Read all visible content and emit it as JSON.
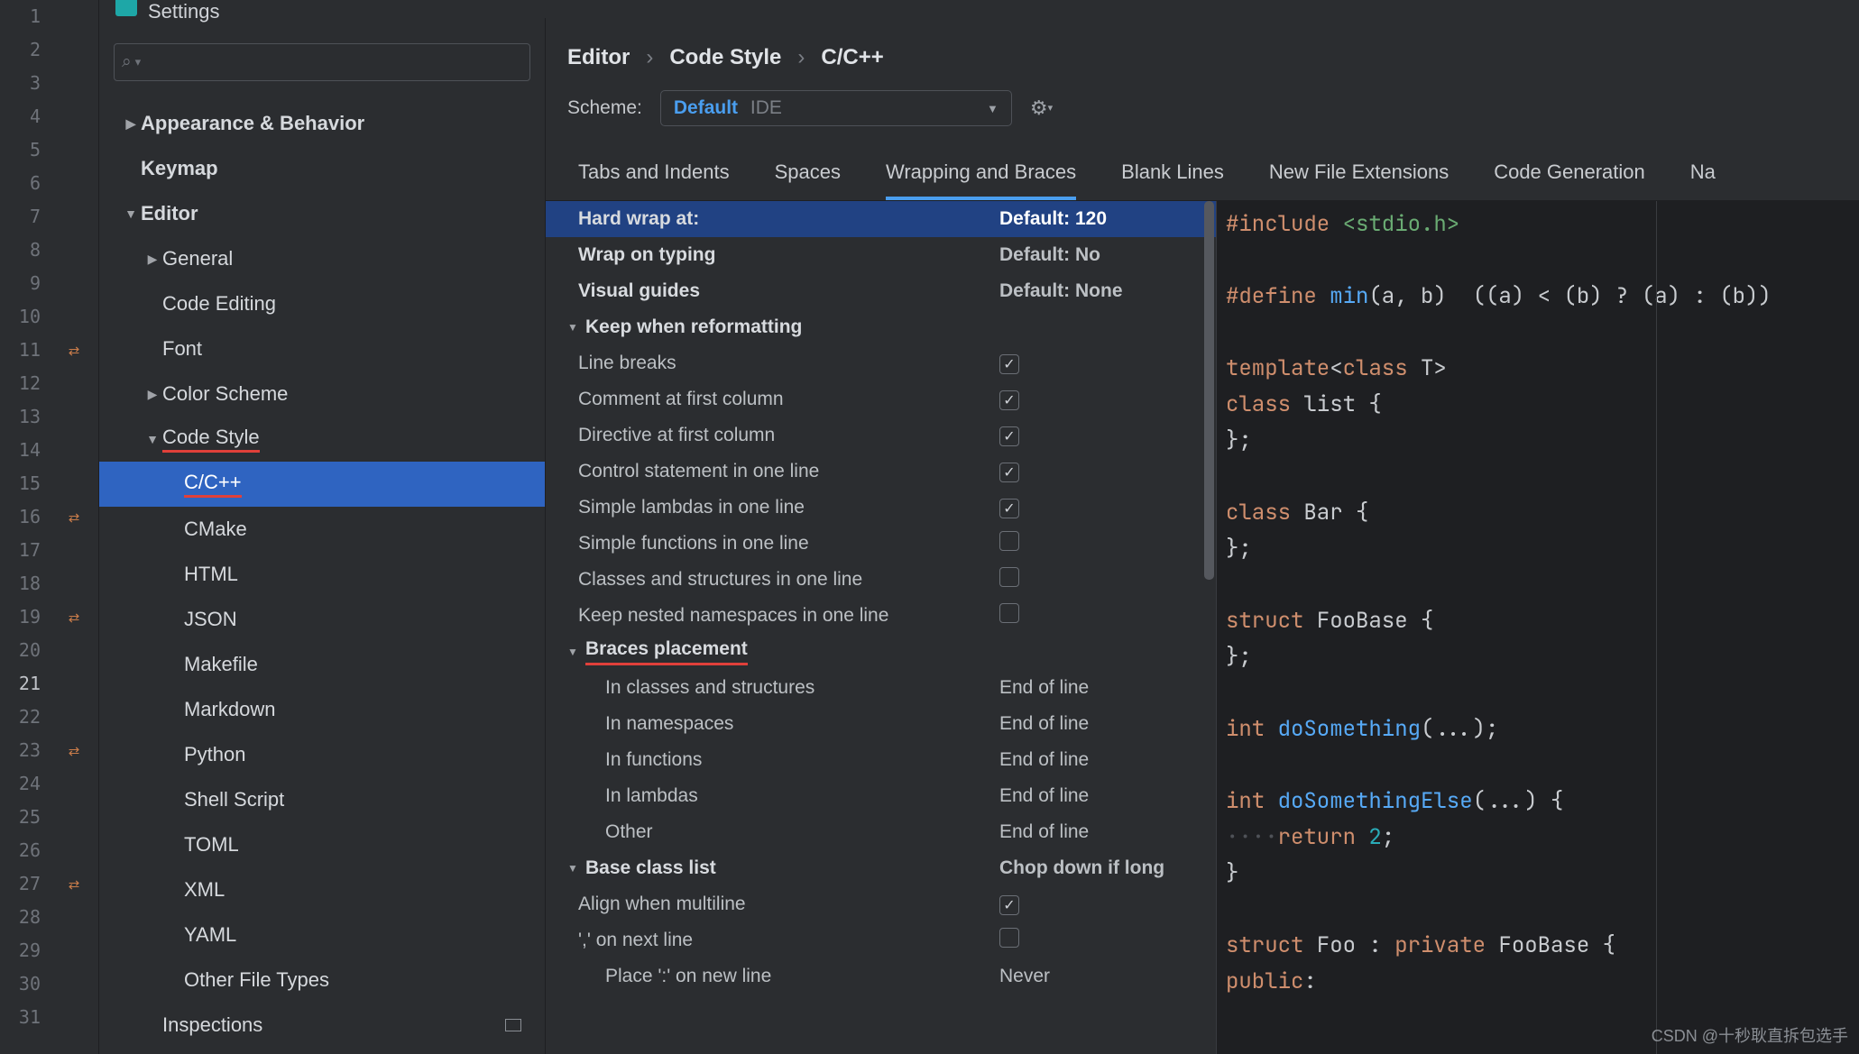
{
  "gutter": {
    "start": 1,
    "end": 31,
    "highlight": 21
  },
  "title": "Settings",
  "search_placeholder": "",
  "tree": [
    {
      "label": "Appearance & Behavior",
      "level": 1,
      "bold": true,
      "arrow": "right"
    },
    {
      "label": "Keymap",
      "level": 1,
      "bold": true,
      "arrow": ""
    },
    {
      "label": "Editor",
      "level": 1,
      "bold": true,
      "arrow": "down"
    },
    {
      "label": "General",
      "level": 2,
      "arrow": "right"
    },
    {
      "label": "Code Editing",
      "level": 2,
      "arrow": ""
    },
    {
      "label": "Font",
      "level": 2,
      "arrow": ""
    },
    {
      "label": "Color Scheme",
      "level": 2,
      "arrow": "right"
    },
    {
      "label": "Code Style",
      "level": 2,
      "arrow": "down",
      "underline": true
    },
    {
      "label": "C/C++",
      "level": 3,
      "sel": true,
      "underline": true
    },
    {
      "label": "CMake",
      "level": 3
    },
    {
      "label": "HTML",
      "level": 3
    },
    {
      "label": "JSON",
      "level": 3
    },
    {
      "label": "Makefile",
      "level": 3
    },
    {
      "label": "Markdown",
      "level": 3
    },
    {
      "label": "Python",
      "level": 3
    },
    {
      "label": "Shell Script",
      "level": 3
    },
    {
      "label": "TOML",
      "level": 3
    },
    {
      "label": "XML",
      "level": 3
    },
    {
      "label": "YAML",
      "level": 3
    },
    {
      "label": "Other File Types",
      "level": 3
    },
    {
      "label": "Inspections",
      "level": 2,
      "icon": "box"
    }
  ],
  "breadcrumb": [
    "Editor",
    "Code Style",
    "C/C++"
  ],
  "scheme": {
    "label": "Scheme:",
    "main": "Default",
    "sub": "IDE"
  },
  "tabs": [
    "Tabs and Indents",
    "Spaces",
    "Wrapping and Braces",
    "Blank Lines",
    "New File Extensions",
    "Code Generation",
    "Na"
  ],
  "active_tab": 2,
  "options": [
    {
      "type": "row",
      "label": "Hard wrap at:",
      "val": "Default: 120",
      "sel": true,
      "bold": true
    },
    {
      "type": "row",
      "label": "Wrap on typing",
      "val": "Default: No",
      "bold": true
    },
    {
      "type": "row",
      "label": "Visual guides",
      "val": "Default: None",
      "bold": true
    },
    {
      "type": "group",
      "label": "Keep when reformatting"
    },
    {
      "type": "chk",
      "label": "Line breaks",
      "on": true
    },
    {
      "type": "chk",
      "label": "Comment at first column",
      "on": true
    },
    {
      "type": "chk",
      "label": "Directive at first column",
      "on": true
    },
    {
      "type": "chk",
      "label": "Control statement in one line",
      "on": true
    },
    {
      "type": "chk",
      "label": "Simple lambdas in one line",
      "on": true
    },
    {
      "type": "chk",
      "label": "Simple functions in one line",
      "on": false
    },
    {
      "type": "chk",
      "label": "Classes and structures in one line",
      "on": false
    },
    {
      "type": "chk",
      "label": "Keep nested namespaces in one line",
      "on": false
    },
    {
      "type": "group",
      "label": "Braces placement",
      "underline": true
    },
    {
      "type": "row",
      "label": "In classes and structures",
      "val": "End of line",
      "ind": true
    },
    {
      "type": "row",
      "label": "In namespaces",
      "val": "End of line",
      "ind": true
    },
    {
      "type": "row",
      "label": "In functions",
      "val": "End of line",
      "ind": true
    },
    {
      "type": "row",
      "label": "In lambdas",
      "val": "End of line",
      "ind": true
    },
    {
      "type": "row",
      "label": "Other",
      "val": "End of line",
      "ind": true
    },
    {
      "type": "group",
      "label": "Base class list",
      "val": "Chop down if long",
      "hasval": true
    },
    {
      "type": "chk",
      "label": "Align when multiline",
      "on": true
    },
    {
      "type": "chk",
      "label": "',' on next line",
      "on": false
    },
    {
      "type": "row",
      "label": "Place ':' on new line",
      "val": "Never",
      "ind": true
    }
  ],
  "preview_lines": [
    [
      [
        "kw",
        "#include "
      ],
      [
        "str",
        "<stdio.h>"
      ]
    ],
    [],
    [
      [
        "kw",
        "#define "
      ],
      [
        "fn",
        "min"
      ],
      [
        "op",
        "(a, b)  ((a) "
      ],
      [
        "op",
        "<"
      ],
      [
        "op",
        " (b) "
      ],
      [
        "op",
        "?"
      ],
      [
        "op",
        " (a) "
      ],
      [
        "op",
        ":"
      ],
      [
        "op",
        " (b))"
      ]
    ],
    [],
    [
      [
        "kw",
        "template"
      ],
      [
        "op",
        "<"
      ],
      [
        "kw",
        "class"
      ],
      [
        "op",
        " "
      ],
      [
        "cls",
        "T"
      ],
      [
        "op",
        ">"
      ]
    ],
    [
      [
        "kw",
        "class"
      ],
      [
        "op",
        " "
      ],
      [
        "cls",
        "list"
      ],
      [
        "op",
        " {"
      ]
    ],
    [
      [
        "op",
        "};"
      ]
    ],
    [],
    [
      [
        "kw",
        "class"
      ],
      [
        "op",
        " "
      ],
      [
        "cls",
        "Bar"
      ],
      [
        "op",
        " {"
      ]
    ],
    [
      [
        "op",
        "};"
      ]
    ],
    [],
    [
      [
        "kw",
        "struct"
      ],
      [
        "op",
        " "
      ],
      [
        "cls",
        "FooBase"
      ],
      [
        "op",
        " {"
      ]
    ],
    [
      [
        "op",
        "};"
      ]
    ],
    [],
    [
      [
        "kw",
        "int"
      ],
      [
        "op",
        " "
      ],
      [
        "fn",
        "doSomething"
      ],
      [
        "op",
        "(...);"
      ]
    ],
    [],
    [
      [
        "kw",
        "int"
      ],
      [
        "op",
        " "
      ],
      [
        "fn",
        "doSomethingElse"
      ],
      [
        "op",
        "(...) {"
      ]
    ],
    [
      [
        "dots",
        "····"
      ],
      [
        "kw",
        "return"
      ],
      [
        "op",
        " "
      ],
      [
        "num",
        "2"
      ],
      [
        "op",
        ";"
      ]
    ],
    [
      [
        "op",
        "}"
      ]
    ],
    [],
    [
      [
        "kw",
        "struct"
      ],
      [
        "op",
        " "
      ],
      [
        "cls",
        "Foo"
      ],
      [
        "op",
        " : "
      ],
      [
        "kw",
        "private"
      ],
      [
        "op",
        " "
      ],
      [
        "cls",
        "FooBase"
      ],
      [
        "op",
        " {"
      ]
    ],
    [
      [
        "kw",
        "public"
      ],
      [
        "op",
        ":"
      ]
    ]
  ],
  "watermark": "CSDN @十秒耿直拆包选手"
}
